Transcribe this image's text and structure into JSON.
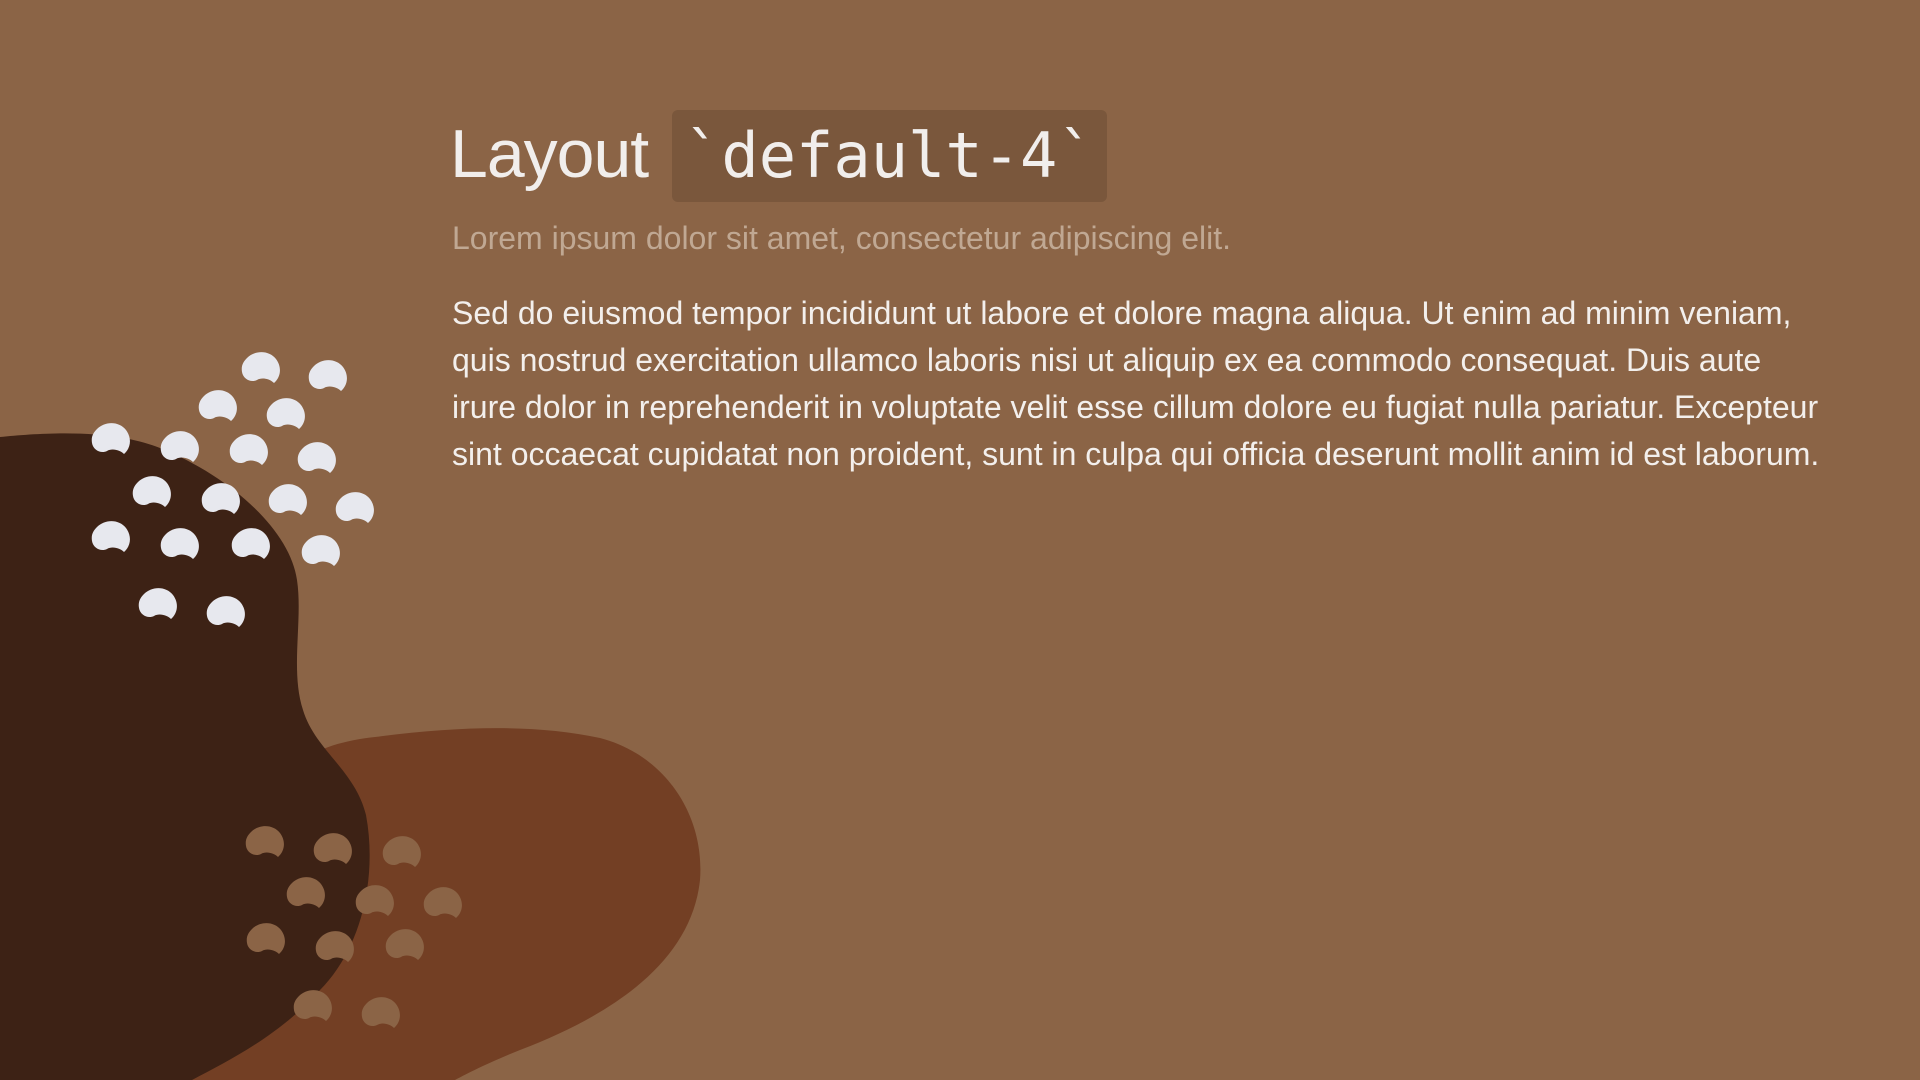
{
  "slide": {
    "title_text": "Layout",
    "title_code": "`default-4`",
    "subtitle": "Lorem ipsum dolor sit amet, consectetur adipiscing elit.",
    "body": "Sed do eiusmod tempor incididunt ut labore et dolore magna aliqua. Ut enim ad minim veniam, quis nostrud exercitation ullamco laboris nisi ut aliquip ex ea commodo consequat. Duis aute irure dolor in reprehenderit in voluptate velit esse cillum dolore eu fugiat nulla pariatur. Excepteur sint occaecat cupidatat non proident, sunt in culpa qui officia deserunt mollit anim id est laborum."
  },
  "colors": {
    "background": "#8b6446",
    "dark_blob": "#3d2215",
    "rust_blob": "#733f24",
    "light_dots": "#e7e8ee",
    "tan_dots": "#8b6446",
    "code_background": "#7a573c",
    "subtitle": "#c0a893",
    "text": "#f1eeec"
  }
}
